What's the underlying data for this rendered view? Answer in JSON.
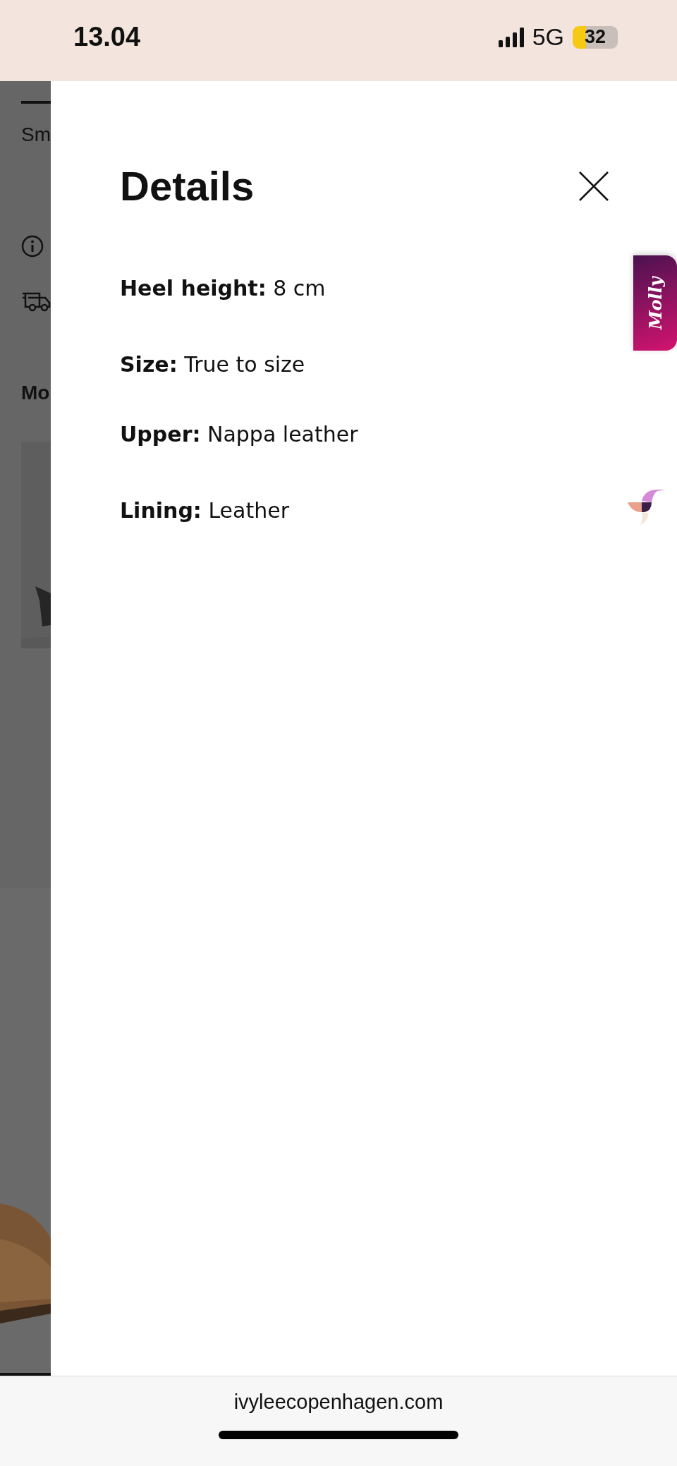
{
  "status_bar": {
    "time": "13.04",
    "network": "5G",
    "battery": "32"
  },
  "background_page": {
    "heading_fragment": "Sm",
    "section_fragment": "Mo"
  },
  "details_panel": {
    "title": "Details",
    "rows": [
      {
        "label": "Heel height:",
        "value": "8 cm"
      },
      {
        "label": "Size:",
        "value": "True to size"
      },
      {
        "label": "Upper:",
        "value": "Nappa leather"
      },
      {
        "label": "Lining:",
        "value": "Leather"
      }
    ]
  },
  "chat_tab": {
    "label": "Molly"
  },
  "browser_bar": {
    "url": "ivyleecopenhagen.com"
  }
}
